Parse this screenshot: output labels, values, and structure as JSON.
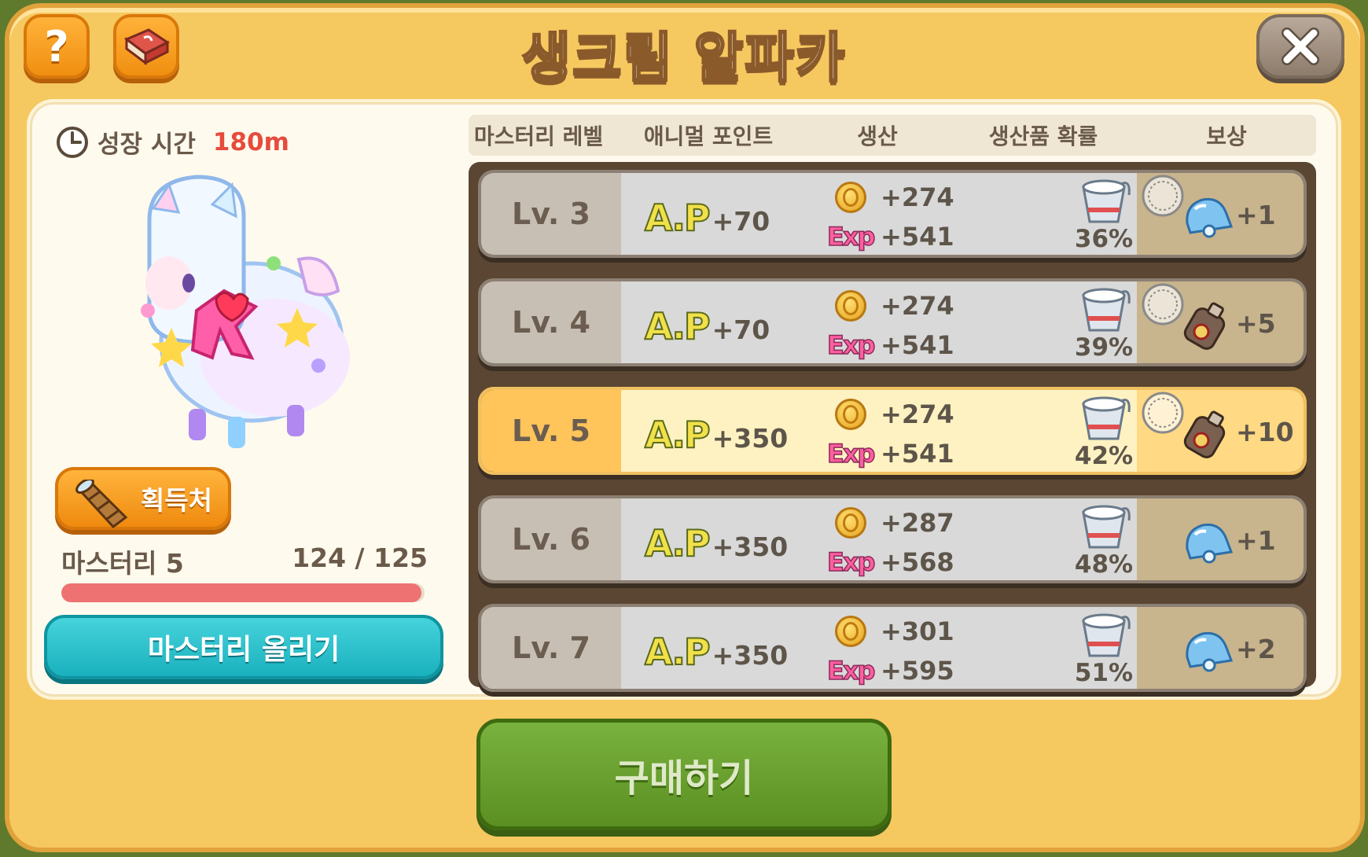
{
  "title": "생크림 알파카",
  "growth": {
    "label": "성장 시간",
    "value": "180m"
  },
  "acquire_label": "획득처",
  "mastery": {
    "label": "마스터리 5",
    "count": "124 / 125",
    "progress": 0.992,
    "button_label": "마스터리 올리기"
  },
  "table_headers": [
    "마스터리 레벨",
    "애니멀 포인트",
    "생산",
    "생산품 확률",
    "보상"
  ],
  "ap_logo": "A.P",
  "exp_logo": "Exp",
  "rows": [
    {
      "level": "Lv. 3",
      "ap": "+70",
      "coin": "+274",
      "exp": "+541",
      "chance": "36%",
      "reward": "+1",
      "reward_icon": "bell-icon",
      "taken": true,
      "active": false
    },
    {
      "level": "Lv. 4",
      "ap": "+70",
      "coin": "+274",
      "exp": "+541",
      "chance": "39%",
      "reward": "+5",
      "reward_icon": "bottle-icon",
      "taken": true,
      "active": false
    },
    {
      "level": "Lv. 5",
      "ap": "+350",
      "coin": "+274",
      "exp": "+541",
      "chance": "42%",
      "reward": "+10",
      "reward_icon": "bottle-icon",
      "taken": true,
      "active": true
    },
    {
      "level": "Lv. 6",
      "ap": "+350",
      "coin": "+287",
      "exp": "+568",
      "chance": "48%",
      "reward": "+1",
      "reward_icon": "bell-icon",
      "taken": false,
      "active": false
    },
    {
      "level": "Lv. 7",
      "ap": "+350",
      "coin": "+301",
      "exp": "+595",
      "chance": "51%",
      "reward": "+2",
      "reward_icon": "bell-icon",
      "taken": false,
      "active": false
    }
  ],
  "buy_label": "구매하기",
  "colors": {
    "accent_orange": "#f08f10",
    "mastery_bar": "#ee7272",
    "teal_button": "#19b1bd",
    "buy_green": "#5b8f22",
    "growth_value": "#e64b3c"
  }
}
